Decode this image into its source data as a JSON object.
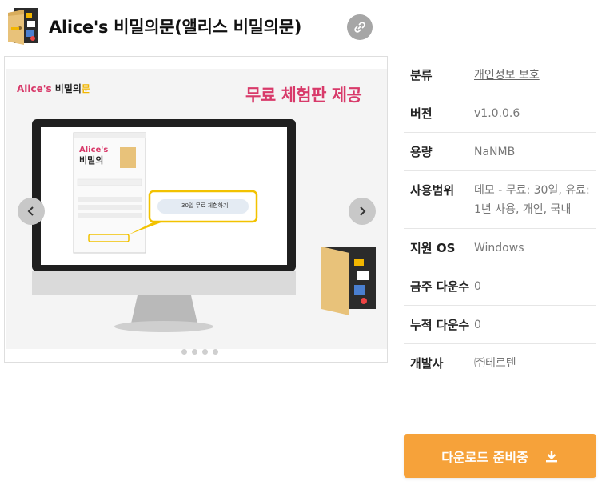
{
  "app": {
    "title": "Alice's 비밀의문(앨리스 비밀의문)"
  },
  "carousel": {
    "brand_prefix": "Alice's",
    "brand_main": "비밀의",
    "brand_accent": "문",
    "promo_text": "무료 체험판 제공",
    "screen_button_label": "30일 무료 체험하기",
    "slide_count": 4,
    "active_slide": 1
  },
  "info": {
    "category_label": "분류",
    "category_value": "개인정보 보호",
    "version_label": "버전",
    "version_value": "v1.0.0.6",
    "size_label": "용량",
    "size_value": "NaNMB",
    "license_label": "사용범위",
    "license_value": "데모 - 무료: 30일, 유료: 1년 사용, 개인, 국내",
    "os_label": "지원 OS",
    "os_value": "Windows",
    "weekly_label": "금주 다운수",
    "weekly_value": "0",
    "total_label": "누적 다운수",
    "total_value": "0",
    "developer_label": "개발사",
    "developer_value": "㈜테르텐"
  },
  "download": {
    "label": "다운로드 준비중"
  },
  "colors": {
    "accent_orange": "#f6a23a",
    "brand_pink": "#d83a6a",
    "callout_yellow": "#f2c200"
  },
  "icons": {
    "link": "link-icon",
    "download": "download-icon",
    "prev": "chevron-left-icon",
    "next": "chevron-right-icon"
  }
}
